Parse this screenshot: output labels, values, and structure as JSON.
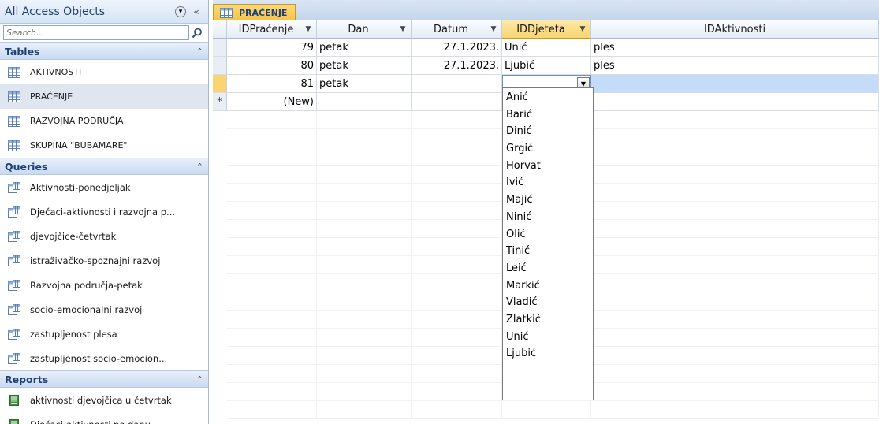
{
  "nav": {
    "title": "All Access Objects",
    "search_placeholder": "Search...",
    "groups": {
      "tables": {
        "label": "Tables",
        "items": [
          "AKTIVNOSTI",
          "PRAĆENJE",
          "RAZVOJNA PODRUČJA",
          "SKUPINA \"BUBAMARE\""
        ]
      },
      "queries": {
        "label": "Queries",
        "items": [
          "Aktivnosti-ponedjeljak",
          "Dječaci-aktivnosti i razvojna p...",
          "djevojčice-četvrtak",
          "istraživačko-spoznajni razvoj",
          "Razvojna područja-petak",
          "socio-emocionalni razvoj",
          "zastupljenost plesa",
          "zastupljenost socio-emocion..."
        ]
      },
      "reports": {
        "label": "Reports",
        "items": [
          "aktivnosti djevojčica u četvrtak",
          "Dječaci-aktivnosti po danu"
        ]
      }
    }
  },
  "document": {
    "tab_label": "PRAĆENJE",
    "columns": [
      "IDPraćenje",
      "Dan",
      "Datum",
      "IDDjeteta",
      "IDAktivnosti"
    ],
    "rows": [
      {
        "id": "79",
        "dan": "petak",
        "datum": "27.1.2023.",
        "dijete": "Unić",
        "aktivnost": "ples"
      },
      {
        "id": "80",
        "dan": "petak",
        "datum": "27.1.2023.",
        "dijete": "Ljubić",
        "aktivnost": "ples"
      },
      {
        "id": "81",
        "dan": "petak",
        "datum": "",
        "dijete": "",
        "aktivnost": ""
      }
    ],
    "new_row_marker": "*",
    "new_row_label": "(New)"
  },
  "dropdown": {
    "options": [
      "Anić",
      "Barić",
      "Dinić",
      "Grgić",
      "Horvat",
      "Ivić",
      "Majić",
      "Ninić",
      "Olić",
      "Tinić",
      "Leić",
      "Markić",
      "Vladić",
      "Zlatkić",
      "Unić",
      "Ljubić"
    ]
  },
  "colors": {
    "accent_tab": "#f6c548",
    "selection": "#c5dcf8",
    "nav_header_text": "#1f3f78"
  }
}
